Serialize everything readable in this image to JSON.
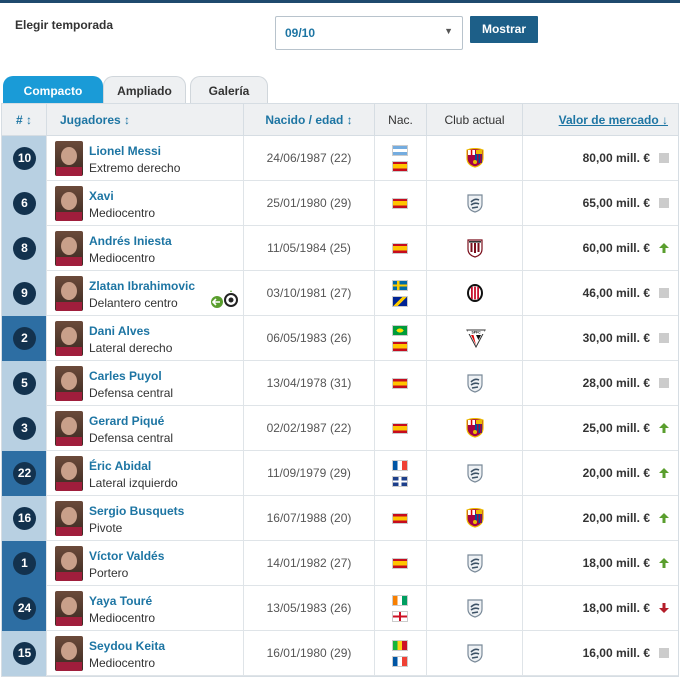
{
  "season": {
    "label": "Elegir temporada",
    "selected": "09/10",
    "button": "Mostrar"
  },
  "tabs": [
    "Compacto",
    "Ampliado",
    "Galería"
  ],
  "columns": {
    "num": "# ↕",
    "player": "Jugadores ↕",
    "born": "Nacido / edad ↕",
    "nat": "Nac.",
    "club": "Club actual",
    "value": "Valor de mercado ↓"
  },
  "colors": {
    "accent": "#1a9bd7",
    "link": "#1d75a3",
    "button": "#1d5f88",
    "up": "#5a9e2e",
    "down": "#b41e2a",
    "same": "#cccccc"
  },
  "players": [
    {
      "num": "10",
      "name": "Lionel Messi",
      "pos": "Extremo derecho",
      "born": "24/06/1987 (22)",
      "flags": [
        "argentina",
        "spain"
      ],
      "club": "fc-barcelona-crest",
      "value": "80,00 mill. €",
      "trend": "same"
    },
    {
      "num": "6",
      "name": "Xavi",
      "pos": "Mediocentro",
      "born": "25/01/1980 (29)",
      "flags": [
        "spain"
      ],
      "club": "retired-crest",
      "value": "65,00 mill. €",
      "trend": "same"
    },
    {
      "num": "8",
      "name": "Andrés Iniesta",
      "pos": "Mediocentro",
      "born": "11/05/1984 (25)",
      "flags": [
        "spain"
      ],
      "club": "vissel-kobe-crest",
      "value": "60,00 mill. €",
      "trend": "up"
    },
    {
      "num": "9",
      "name": "Zlatan Ibrahimovic",
      "pos": "Delantero centro",
      "born": "03/10/1981 (27)",
      "flags": [
        "sweden",
        "bosnia"
      ],
      "club": "ac-milan-crest",
      "value": "46,00 mill. €",
      "trend": "same"
    },
    {
      "num": "2",
      "name": "Dani Alves",
      "pos": "Lateral derecho",
      "born": "06/05/1983 (26)",
      "flags": [
        "brazil",
        "spain"
      ],
      "club": "sao-paulo-crest",
      "value": "30,00 mill. €",
      "trend": "same"
    },
    {
      "num": "5",
      "name": "Carles Puyol",
      "pos": "Defensa central",
      "born": "13/04/1978 (31)",
      "flags": [
        "spain"
      ],
      "club": "retired-crest",
      "value": "28,00 mill. €",
      "trend": "same"
    },
    {
      "num": "3",
      "name": "Gerard Piqué",
      "pos": "Defensa central",
      "born": "02/02/1987 (22)",
      "flags": [
        "spain"
      ],
      "club": "fc-barcelona-crest",
      "value": "25,00 mill. €",
      "trend": "up"
    },
    {
      "num": "22",
      "name": "Éric Abidal",
      "pos": "Lateral izquierdo",
      "born": "11/09/1979 (29)",
      "flags": [
        "france",
        "martinique"
      ],
      "club": "retired-crest",
      "value": "20,00 mill. €",
      "trend": "up"
    },
    {
      "num": "16",
      "name": "Sergio Busquets",
      "pos": "Pivote",
      "born": "16/07/1988 (20)",
      "flags": [
        "spain"
      ],
      "club": "fc-barcelona-crest",
      "value": "20,00 mill. €",
      "trend": "up"
    },
    {
      "num": "1",
      "name": "Víctor Valdés",
      "pos": "Portero",
      "born": "14/01/1982 (27)",
      "flags": [
        "spain"
      ],
      "club": "retired-crest",
      "value": "18,00 mill. €",
      "trend": "up"
    },
    {
      "num": "24",
      "name": "Yaya Touré",
      "pos": "Mediocentro",
      "born": "13/05/1983 (26)",
      "flags": [
        "ivory-coast",
        "england"
      ],
      "club": "retired-crest",
      "value": "18,00 mill. €",
      "trend": "down"
    },
    {
      "num": "15",
      "name": "Seydou Keita",
      "pos": "Mediocentro",
      "born": "16/01/1980 (29)",
      "flags": [
        "mali",
        "france"
      ],
      "club": "retired-crest",
      "value": "16,00 mill. €",
      "trend": "same"
    }
  ]
}
